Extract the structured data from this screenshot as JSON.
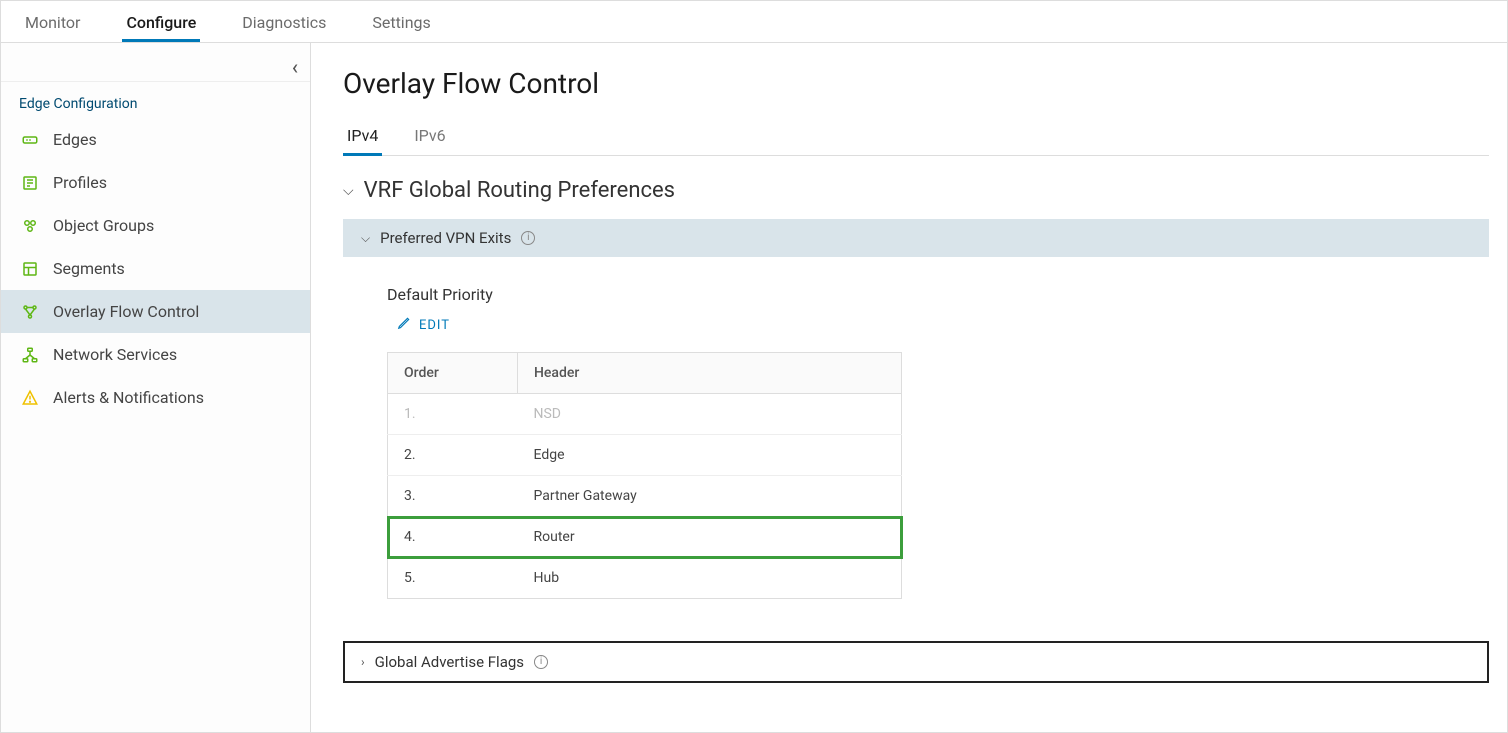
{
  "topTabs": {
    "monitor": "Monitor",
    "configure": "Configure",
    "diagnostics": "Diagnostics",
    "settings": "Settings"
  },
  "sidebar": {
    "sectionTitle": "Edge Configuration",
    "items": {
      "edges": "Edges",
      "profiles": "Profiles",
      "objectGroups": "Object Groups",
      "segments": "Segments",
      "overlayFlowControl": "Overlay Flow Control",
      "networkServices": "Network Services",
      "alerts": "Alerts & Notifications"
    }
  },
  "page": {
    "title": "Overlay Flow Control",
    "subtabs": {
      "ipv4": "IPv4",
      "ipv6": "IPv6"
    },
    "sectionTitle": "VRF Global Routing Preferences",
    "panelVpnExits": "Preferred VPN Exits",
    "defaultPriority": "Default Priority",
    "editLabel": "EDIT",
    "table": {
      "colOrder": "Order",
      "colHeader": "Header",
      "rows": [
        {
          "order": "1.",
          "header": "NSD",
          "dim": true
        },
        {
          "order": "2.",
          "header": "Edge"
        },
        {
          "order": "3.",
          "header": "Partner Gateway"
        },
        {
          "order": "4.",
          "header": "Router",
          "highlight": true
        },
        {
          "order": "5.",
          "header": "Hub"
        }
      ]
    },
    "panelFlags": "Global Advertise Flags"
  }
}
